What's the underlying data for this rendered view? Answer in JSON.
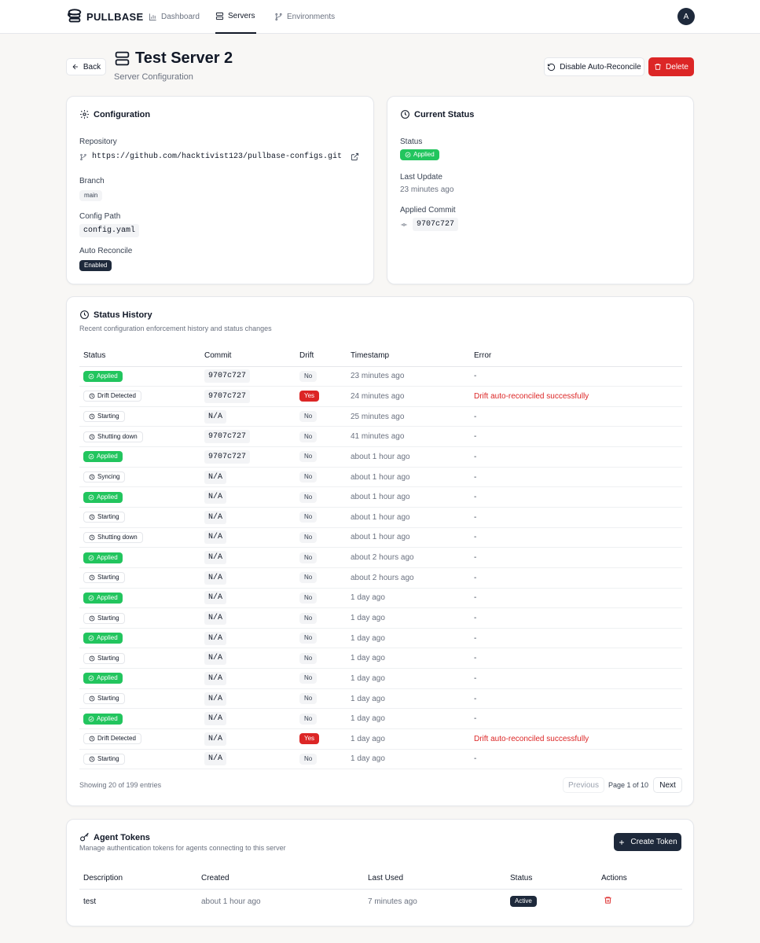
{
  "nav": {
    "brand": "PULLBASE",
    "items": [
      {
        "label": "Dashboard",
        "icon": "bar-chart-icon"
      },
      {
        "label": "Servers",
        "icon": "server-icon",
        "active": true
      },
      {
        "label": "Environments",
        "icon": "git-branch-icon"
      }
    ],
    "avatar": "A"
  },
  "header": {
    "back": "Back",
    "title": "Test Server 2",
    "subtitle": "Server Configuration",
    "disable_btn": "Disable Auto-Reconcile",
    "delete_btn": "Delete"
  },
  "config": {
    "title": "Configuration",
    "repository_label": "Repository",
    "repository": "https://github.com/hacktivist123/pullbase-configs.git",
    "branch_label": "Branch",
    "branch": "main",
    "path_label": "Config Path",
    "path": "config.yaml",
    "auto_label": "Auto Reconcile",
    "auto": "Enabled"
  },
  "current": {
    "title": "Current Status",
    "status_label": "Status",
    "status": "Applied",
    "last_update_label": "Last Update",
    "last_update": "23 minutes ago",
    "commit_label": "Applied Commit",
    "commit": "9707c727"
  },
  "history": {
    "title": "Status History",
    "subtitle": "Recent configuration enforcement history and status changes",
    "columns": [
      "Status",
      "Commit",
      "Drift",
      "Timestamp",
      "Error"
    ],
    "rows": [
      {
        "status": "Applied",
        "commit": "9707c727",
        "drift": "No",
        "time": "23 minutes ago",
        "error": "-"
      },
      {
        "status": "Drift Detected",
        "commit": "9707c727",
        "drift": "Yes",
        "time": "24 minutes ago",
        "error": "Drift auto-reconciled successfully"
      },
      {
        "status": "Starting",
        "commit": "N/A",
        "drift": "No",
        "time": "25 minutes ago",
        "error": "-"
      },
      {
        "status": "Shutting down",
        "commit": "9707c727",
        "drift": "No",
        "time": "41 minutes ago",
        "error": "-"
      },
      {
        "status": "Applied",
        "commit": "9707c727",
        "drift": "No",
        "time": "about 1 hour ago",
        "error": "-"
      },
      {
        "status": "Syncing",
        "commit": "N/A",
        "drift": "No",
        "time": "about 1 hour ago",
        "error": "-"
      },
      {
        "status": "Applied",
        "commit": "N/A",
        "drift": "No",
        "time": "about 1 hour ago",
        "error": "-"
      },
      {
        "status": "Starting",
        "commit": "N/A",
        "drift": "No",
        "time": "about 1 hour ago",
        "error": "-"
      },
      {
        "status": "Shutting down",
        "commit": "N/A",
        "drift": "No",
        "time": "about 1 hour ago",
        "error": "-"
      },
      {
        "status": "Applied",
        "commit": "N/A",
        "drift": "No",
        "time": "about 2 hours ago",
        "error": "-"
      },
      {
        "status": "Starting",
        "commit": "N/A",
        "drift": "No",
        "time": "about 2 hours ago",
        "error": "-"
      },
      {
        "status": "Applied",
        "commit": "N/A",
        "drift": "No",
        "time": "1 day ago",
        "error": "-"
      },
      {
        "status": "Starting",
        "commit": "N/A",
        "drift": "No",
        "time": "1 day ago",
        "error": "-"
      },
      {
        "status": "Applied",
        "commit": "N/A",
        "drift": "No",
        "time": "1 day ago",
        "error": "-"
      },
      {
        "status": "Starting",
        "commit": "N/A",
        "drift": "No",
        "time": "1 day ago",
        "error": "-"
      },
      {
        "status": "Applied",
        "commit": "N/A",
        "drift": "No",
        "time": "1 day ago",
        "error": "-"
      },
      {
        "status": "Starting",
        "commit": "N/A",
        "drift": "No",
        "time": "1 day ago",
        "error": "-"
      },
      {
        "status": "Applied",
        "commit": "N/A",
        "drift": "No",
        "time": "1 day ago",
        "error": "-"
      },
      {
        "status": "Drift Detected",
        "commit": "N/A",
        "drift": "Yes",
        "time": "1 day ago",
        "error": "Drift auto-reconciled successfully"
      },
      {
        "status": "Starting",
        "commit": "N/A",
        "drift": "No",
        "time": "1 day ago",
        "error": "-"
      }
    ],
    "showing": "Showing 20 of 199 entries",
    "previous": "Previous",
    "page": "Page 1 of 10",
    "next": "Next"
  },
  "tokens": {
    "title": "Agent Tokens",
    "subtitle": "Manage authentication tokens for agents connecting to this server",
    "create_btn": "Create Token",
    "columns": [
      "Description",
      "Created",
      "Last Used",
      "Status",
      "Actions"
    ],
    "rows": [
      {
        "description": "test",
        "created": "about 1 hour ago",
        "last_used": "7 minutes ago",
        "status": "Active"
      }
    ]
  },
  "colors": {
    "applied": "#22c55e",
    "danger": "#dc2626",
    "dark": "#1e293b"
  }
}
